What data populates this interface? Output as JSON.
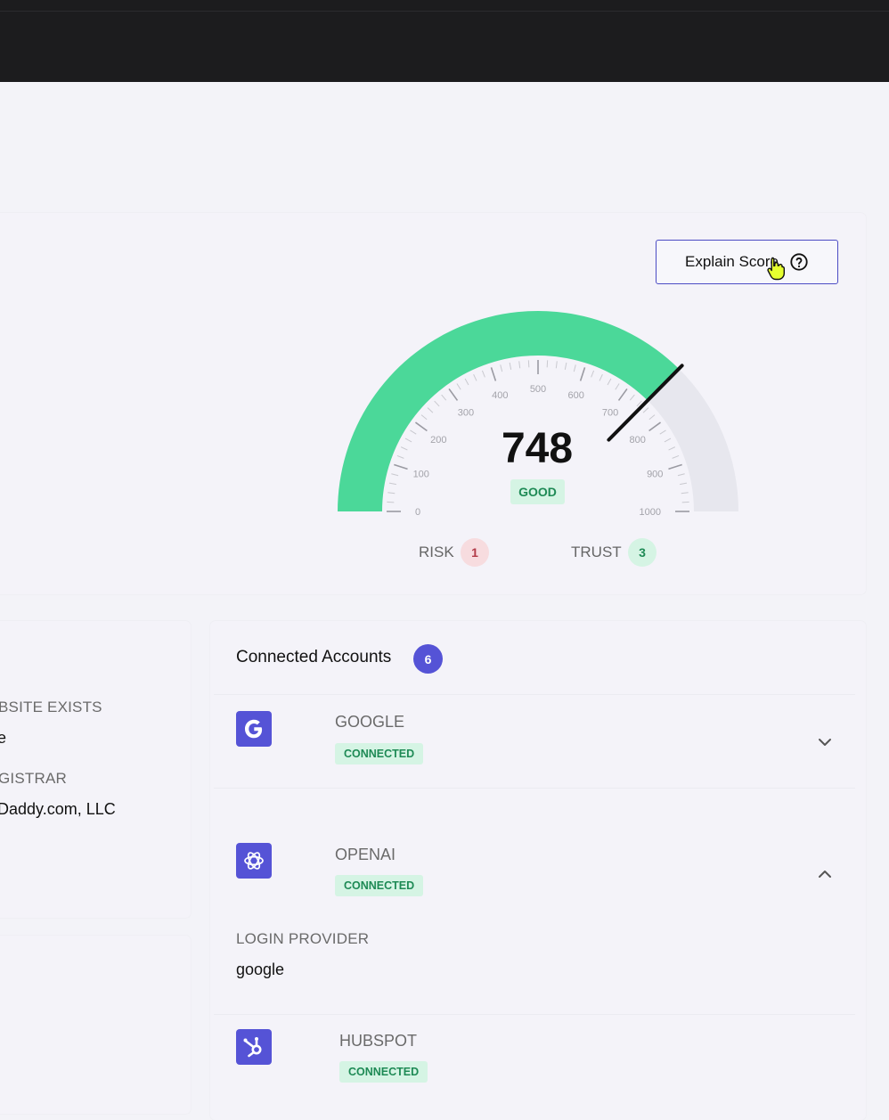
{
  "score": {
    "explain_label": "Explain Score",
    "value": "748",
    "rating": "GOOD",
    "gauge_min": 0,
    "gauge_max": 1000,
    "gauge_value": 748,
    "ticks": [
      "0",
      "100",
      "200",
      "300",
      "400",
      "500",
      "600",
      "700",
      "800",
      "900",
      "1000"
    ],
    "risk_label": "RISK",
    "risk_count": "1",
    "trust_label": "TRUST",
    "trust_count": "3",
    "colors": {
      "fill": "#4bd899",
      "track": "#e7e7ee",
      "needle": "#111111",
      "accent": "#5553d6"
    }
  },
  "left": {
    "field1_label": "BSITE EXISTS",
    "field1_value": "e",
    "field2_label": "GISTRAR",
    "field2_value": "Daddy.com, LLC"
  },
  "accounts": {
    "title": "Connected Accounts",
    "count": "6",
    "items": [
      {
        "name": "GOOGLE",
        "status": "CONNECTED",
        "icon": "google-g-icon",
        "expanded": false
      },
      {
        "name": "OPENAI",
        "status": "CONNECTED",
        "icon": "openai-icon",
        "expanded": true,
        "detail_label": "LOGIN PROVIDER",
        "detail_value": "google"
      },
      {
        "name": "HUBSPOT",
        "status": "CONNECTED",
        "icon": "hubspot-icon",
        "expanded": false
      }
    ]
  }
}
